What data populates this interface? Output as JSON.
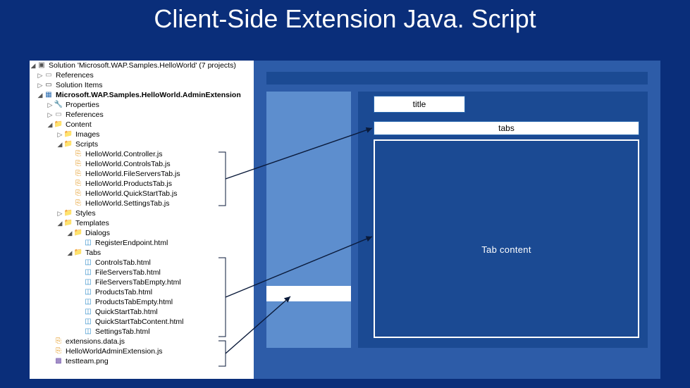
{
  "slide": {
    "heading": "Client-Side Extension Java. Script"
  },
  "solution": {
    "root": "Solution 'Microsoft.WAP.Samples.HelloWorld' (7 projects)",
    "rootChildren": [
      {
        "collapsed": true,
        "icon": "ref",
        "label": "References"
      },
      {
        "collapsed": true,
        "icon": "fold",
        "label": "Solution Items"
      }
    ],
    "project": "Microsoft.WAP.Samples.HelloWorld.AdminExtension",
    "projectChildren": [
      {
        "collapsed": true,
        "icon": "tool",
        "label": "Properties"
      },
      {
        "collapsed": true,
        "icon": "ref",
        "label": "References"
      }
    ],
    "content": {
      "label": "Content",
      "images": "Images",
      "scripts": {
        "label": "Scripts",
        "files": [
          "HelloWorld.Controller.js",
          "HelloWorld.ControlsTab.js",
          "HelloWorld.FileServersTab.js",
          "HelloWorld.ProductsTab.js",
          "HelloWorld.QuickStartTab.js",
          "HelloWorld.SettingsTab.js"
        ]
      },
      "styles": "Styles",
      "templates": {
        "label": "Templates",
        "dialogs": {
          "label": "Dialogs",
          "files": [
            "RegisterEndpoint.html"
          ]
        },
        "tabs": {
          "label": "Tabs",
          "files": [
            "ControlsTab.html",
            "FileServersTab.html",
            "FileServersTabEmpty.html",
            "ProductsTab.html",
            "ProductsTabEmpty.html",
            "QuickStartTab.html",
            "QuickStartTabContent.html",
            "SettingsTab.html"
          ]
        }
      }
    },
    "rootFiles": [
      {
        "icon": "js",
        "label": "extensions.data.js"
      },
      {
        "icon": "js",
        "label": "HelloWorldAdminExtension.js"
      },
      {
        "icon": "img",
        "label": "testteam.png"
      }
    ]
  },
  "wireframe": {
    "title_label": "title",
    "tabs_label": "tabs",
    "content_label": "Tab content"
  },
  "arrows": {
    "scripts_target": "tabs",
    "templates_target": "content",
    "rootfiles_target": "sidebar"
  }
}
